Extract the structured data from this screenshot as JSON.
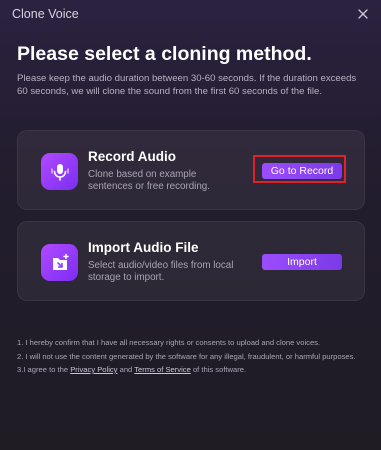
{
  "window": {
    "title": "Clone Voice"
  },
  "heading": "Please select a cloning method.",
  "subtext": "Please keep the audio duration between 30-60 seconds. If the duration exceeds 60 seconds, we will clone the sound from the first 60 seconds of the file.",
  "options": [
    {
      "title": "Record Audio",
      "description": "Clone based on example sentences or free recording.",
      "button_label": "Go to Record",
      "icon": "microphone-icon"
    },
    {
      "title": "Import Audio File",
      "description": "Select audio/video files from local storage to import.",
      "button_label": "Import",
      "icon": "import-file-icon"
    }
  ],
  "terms": {
    "line1": "1. I hereby confirm that I have all necessary rights or consents to upload and clone voices.",
    "line2": "2. I will not use the content generated by the software for any illegal, fraudulent, or harmful purposes.",
    "line3_prefix": "3.I agree to the",
    "privacy_link": "Privacy Policy",
    "and": "and",
    "tos_link": "Terms of Service",
    "line3_suffix": "of this software."
  },
  "colors": {
    "accent": "#8a44f5",
    "highlight": "#e0202a",
    "background": "#231d2f"
  }
}
